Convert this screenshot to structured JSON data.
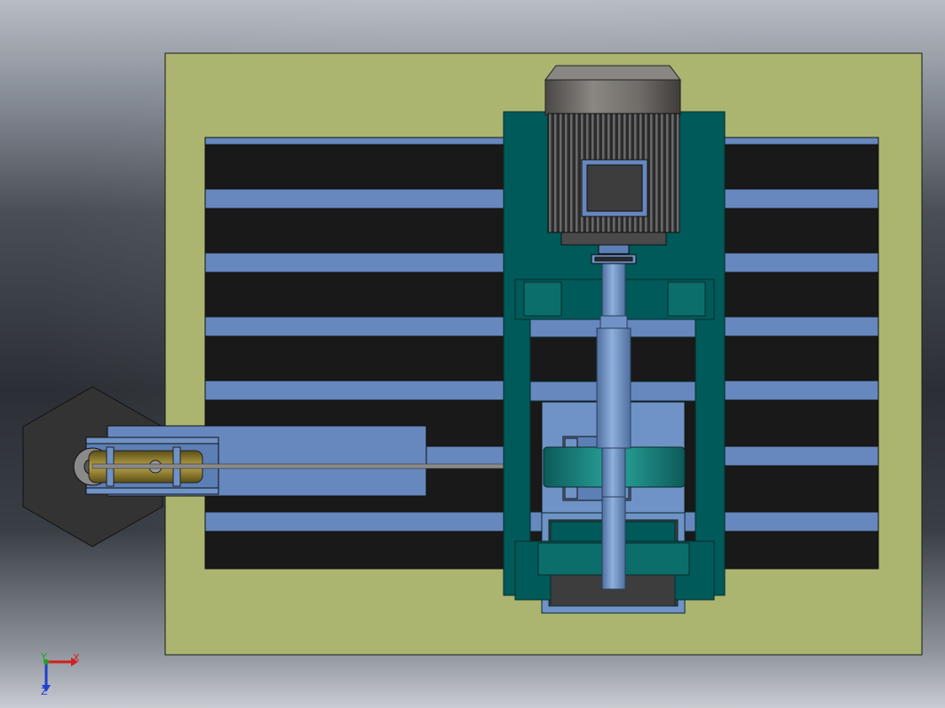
{
  "viewport": {
    "background_colors": [
      "#b8bcc4",
      "#2b2f35",
      "#c9ccd2"
    ]
  },
  "model": {
    "colors": {
      "base_plate": "#abb570",
      "rail_dark": "#191919",
      "rail_light": "#6688bf",
      "frame_teal": "#005a5a",
      "frame_teal_light": "#0c7a72",
      "motor_body": "#3d3d3d",
      "motor_cap": "#6f6c68",
      "shaft_blue": "#6f93c6",
      "hex_dark": "#333333",
      "pulley_brass": "#8a7a2a"
    },
    "parts": [
      "base-plate",
      "rails",
      "hexagon-block",
      "slider-housing",
      "pulley",
      "cable",
      "frame",
      "motor",
      "coupling",
      "bearing-block-top",
      "lead-screw",
      "carriage",
      "drum",
      "bearing-block-bottom",
      "motor-base"
    ]
  },
  "triad": {
    "x_label": "X",
    "y_label": "Y",
    "z_label": "Z",
    "x_color": "#d02020",
    "y_color": "#20a020",
    "z_color": "#2040d0"
  }
}
